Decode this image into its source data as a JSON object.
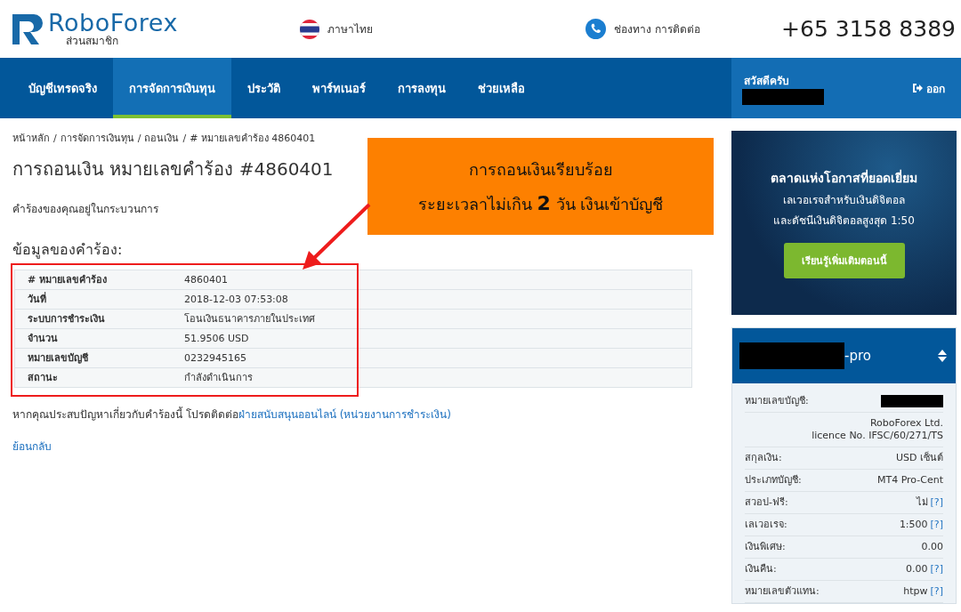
{
  "header": {
    "logo_text": "RoboForex",
    "logo_subtitle": "ส่วนสมาชิก",
    "language": "ภาษาไทย",
    "contact": "ช่องทาง การติดต่อ",
    "phone": "+65 3158 8389"
  },
  "nav": {
    "items": [
      {
        "label": "บัญชีเทรดจริง",
        "selected": false
      },
      {
        "label": "การจัดการเงินทุน",
        "selected": true
      },
      {
        "label": "ประวัติ",
        "selected": false
      },
      {
        "label": "พาร์ทเนอร์",
        "selected": false
      },
      {
        "label": "การลงทุน",
        "selected": false
      },
      {
        "label": "ช่วยเหลือ",
        "selected": false
      }
    ],
    "greeting": "สวัสดีครับ",
    "logout": "ออก"
  },
  "breadcrumb": {
    "separator": "/",
    "items": [
      "หน้าหลัก",
      "การจัดการเงินทุน",
      "ถอนเงิน",
      "# หมายเลขคำร้อง 4860401"
    ]
  },
  "title": "การถอนเงิน หมายเลขคำร้อง #4860401",
  "status_text": "คำร้องของคุณอยู่ในกระบวนการ",
  "section_title": "ข้อมูลของคำร้อง:",
  "details": [
    {
      "label": "# หมายเลขคำร้อง",
      "value": "4860401"
    },
    {
      "label": "วันที่",
      "value": "2018-12-03 07:53:08"
    },
    {
      "label": "ระบบการชำระเงิน",
      "value": "โอนเงินธนาคารภายในประเทศ"
    },
    {
      "label": "จำนวน",
      "value": "51.9506 USD"
    },
    {
      "label": "หมายเลขบัญชี",
      "value": "0232945165"
    },
    {
      "label": "สถานะ",
      "value": "กำลังดำเนินการ"
    }
  ],
  "help_text": {
    "prefix": "หากคุณประสบปัญหาเกี่ยวกับคำร้องนี้ โปรดติดต่อ",
    "link": "ฝ่ายสนับสนุนออนไลน์ (หน่วยงานการชำระเงิน)"
  },
  "back_link": "ย้อนกลับ",
  "annotation": {
    "line_1": "การถอนเงินเรียบร้อย",
    "line_2": "ระยะเวลาไม่เกิน **2** วัน เงินเข้าบัญชี"
  },
  "promo": {
    "title": "ตลาดแห่งโอกาสที่ยอดเยี่ยม",
    "subtitle_1": "เลเวอเรจสำหรับเงินดิจิตอล",
    "subtitle_2": "และดัชนีเงินดิจิตอลสูงสุด 1:50",
    "button": "เรียนรู้เพิ่มเติมตอนนี้"
  },
  "account": {
    "name_suffix": "-pro",
    "rows": [
      {
        "kind": "redacted",
        "label": "หมายเลขบัญชี:"
      },
      {
        "kind": "note",
        "lines": [
          "RoboForex Ltd.",
          "licence No. IFSC/60/271/TS"
        ]
      },
      {
        "kind": "text",
        "label": "สกุลเงิน:",
        "value": "USD เซ็นต์"
      },
      {
        "kind": "text",
        "label": "ประเภทบัญชี:",
        "value": "MT4 Pro-Cent"
      },
      {
        "kind": "text",
        "label": "สวอป-ฟรี:",
        "value": "ไม่",
        "help": "[?]"
      },
      {
        "kind": "text",
        "label": "เลเวอเรจ:",
        "value": "1:500",
        "help": "[?]"
      },
      {
        "kind": "text",
        "label": "เงินพิเศษ:",
        "value": "0.00"
      },
      {
        "kind": "text",
        "label": "เงินคืน:",
        "value": "0.00",
        "help": "[?]"
      },
      {
        "kind": "text",
        "label": "หมายเลขตัวแทน:",
        "value": "htpw",
        "help": "[?]"
      }
    ]
  }
}
